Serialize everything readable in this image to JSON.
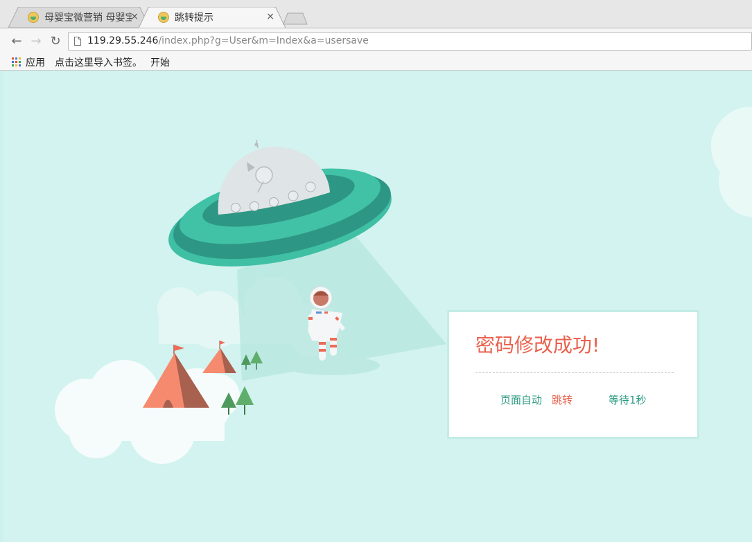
{
  "browser": {
    "tabs": [
      {
        "title": "母婴宝微营销 母婴宝",
        "close": "×",
        "active": false
      },
      {
        "title": "跳转提示",
        "close": "×",
        "active": true
      }
    ],
    "nav": {
      "back": "←",
      "forward": "→",
      "reload": "↻"
    },
    "address": {
      "host": "119.29.55.246",
      "path": "/index.php?g=User&m=Index&a=usersave"
    },
    "bookmarks": {
      "apps": "应用",
      "hint": "点击这里导入书签。",
      "start": "开始"
    }
  },
  "message": {
    "title": "密码修改成功!",
    "auto_label": "页面自动",
    "jump_link": "跳转",
    "wait_text": "等待1秒"
  },
  "colors": {
    "background": "#d2f3ef",
    "title": "#e8614d",
    "accent_green": "#2b9a82"
  }
}
